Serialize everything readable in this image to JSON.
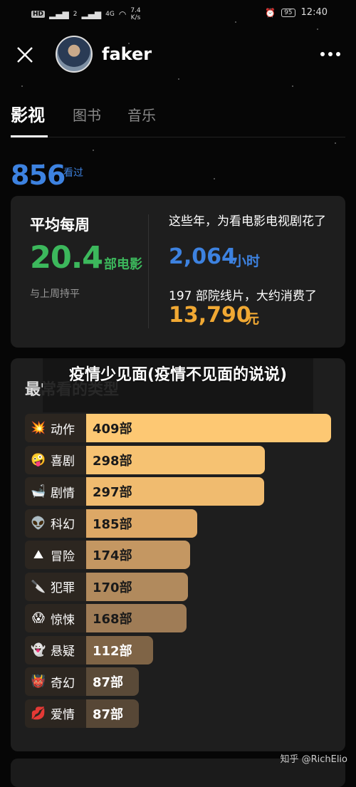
{
  "status_bar": {
    "hd": "HD",
    "signal1": "2",
    "signal2": "4G",
    "speed_value": "7.4",
    "speed_unit": "K/s",
    "battery": "95",
    "time": "12:40"
  },
  "header": {
    "username": "faker"
  },
  "tabs": [
    "影视",
    "图书",
    "音乐"
  ],
  "watched": {
    "count": "856",
    "label": "看过"
  },
  "weekly": {
    "title": "平均每周",
    "value": "20.4",
    "unit": "部电影",
    "compare": "与上周持平"
  },
  "years": {
    "title": "这些年，为看电影电视剧花了",
    "hours": "2,064",
    "hours_unit": "小时",
    "cinema_text": "197 部院线片，大约消费了",
    "cost": "13,790",
    "cost_unit": "元"
  },
  "genres_card": {
    "title": "最常看的类型",
    "overlay": "疫情少见面(疫情不见面的说说)"
  },
  "genres": [
    {
      "emoji": "💥",
      "name": "动作",
      "count": "409部",
      "value": 409,
      "color": "#fdc873"
    },
    {
      "emoji": "🤪",
      "name": "喜剧",
      "count": "298部",
      "value": 298,
      "color": "#f6c272"
    },
    {
      "emoji": "🛁",
      "name": "剧情",
      "count": "297部",
      "value": 297,
      "color": "#f0bb6f"
    },
    {
      "emoji": "👽",
      "name": "科幻",
      "count": "185部",
      "value": 185,
      "color": "#dda866"
    },
    {
      "emoji": "⛰",
      "name": "冒险",
      "count": "174部",
      "value": 174,
      "color": "#c49762"
    },
    {
      "emoji": "🔪",
      "name": "犯罪",
      "count": "170部",
      "value": 170,
      "color": "#b18a5d"
    },
    {
      "emoji": "😱",
      "name": "惊悚",
      "count": "168部",
      "value": 168,
      "color": "#9f7c56"
    },
    {
      "emoji": "👻",
      "name": "悬疑",
      "count": "112部",
      "value": 112,
      "color": "#7f6446"
    },
    {
      "emoji": "👹",
      "name": "奇幻",
      "count": "87部",
      "value": 87,
      "color": "#5a4a38"
    },
    {
      "emoji": "💋",
      "name": "爱情",
      "count": "87部",
      "value": 87,
      "color": "#574736"
    }
  ],
  "watermark": "知乎 @RichElio"
}
